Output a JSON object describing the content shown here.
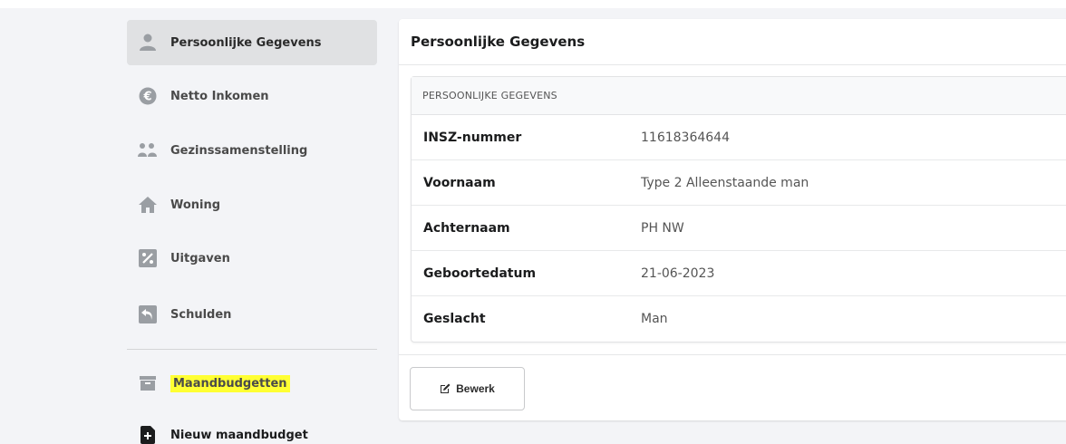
{
  "sidebar": {
    "items": [
      {
        "label": "Persoonlijke Gegevens",
        "icon": "user-icon",
        "active": true
      },
      {
        "label": "Netto Inkomen",
        "icon": "euro-icon"
      },
      {
        "label": "Gezinssamenstelling",
        "icon": "users-icon"
      },
      {
        "label": "Woning",
        "icon": "home-icon"
      },
      {
        "label": "Uitgaven",
        "icon": "percent-receipt-icon"
      },
      {
        "label": "Schulden",
        "icon": "debt-icon"
      }
    ],
    "budgets_label": "Maandbudgetten",
    "budgets_icon": "archive-icon",
    "new_budget_label": "Nieuw maandbudget",
    "new_budget_icon": "add-file-icon"
  },
  "main": {
    "title": "Persoonlijke Gegevens",
    "section_header": "PERSOONLIJKE GEGEVENS",
    "rows": [
      {
        "label": "INSZ-nummer",
        "value": "11618364644"
      },
      {
        "label": "Voornaam",
        "value": "Type 2 Alleenstaande man"
      },
      {
        "label": "Achternaam",
        "value": "PH NW"
      },
      {
        "label": "Geboortedatum",
        "value": "21-06-2023"
      },
      {
        "label": "Geslacht",
        "value": "Man"
      }
    ],
    "edit_label": "Bewerk",
    "edit_icon": "edit-icon"
  },
  "colors": {
    "highlight": "#ffff33",
    "active_bg": "#e0e1e3",
    "icon_gray": "#9a9ea3"
  }
}
